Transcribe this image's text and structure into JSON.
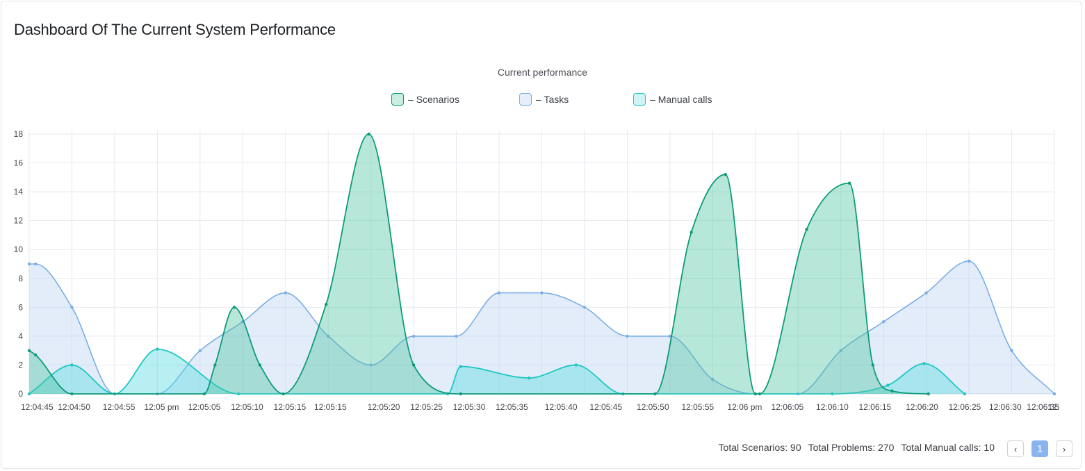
{
  "page": {
    "title": "Dashboard Of The Current System Performance"
  },
  "colors": {
    "scenarios_line": "#0e9b78",
    "scenarios_fill": "#4cc3a0",
    "tasks_line": "#7aaee6",
    "tasks_fill": "#a9c8f0",
    "manual_line": "#1fc7c4",
    "manual_fill": "#5fdbe2",
    "grid": "#e4e9f0"
  },
  "legend": [
    {
      "label": "Scenarios",
      "series": "scenarios"
    },
    {
      "label": "Tasks",
      "series": "tasks"
    },
    {
      "label": "Manual calls",
      "series": "manual"
    }
  ],
  "footer": {
    "scenarios_text": "Total Scenarios: 90",
    "problems_text": "Total Problems: 270",
    "manual_text": "Total Manual calls: 10"
  },
  "pagination": {
    "prev": "‹",
    "current": "1",
    "next": "›"
  },
  "chart_data": {
    "type": "area",
    "title": "Current performance",
    "ylim": [
      0,
      18
    ],
    "yticks": [
      0,
      2,
      4,
      6,
      8,
      10,
      12,
      14,
      16,
      18
    ],
    "xlim": [
      0,
      24
    ],
    "xticks": [
      {
        "x": 0.18,
        "label": "12:04:45"
      },
      {
        "x": 1.05,
        "label": "12:04:50"
      },
      {
        "x": 2.1,
        "label": "12:04:55"
      },
      {
        "x": 3.1,
        "label": "12:05 pm"
      },
      {
        "x": 4.1,
        "label": "12:05:05"
      },
      {
        "x": 5.1,
        "label": "12:05:10"
      },
      {
        "x": 6.1,
        "label": "12:05:15"
      },
      {
        "x": 7.05,
        "label": "12:05:15"
      },
      {
        "x": 8.3,
        "label": "12:05:20"
      },
      {
        "x": 9.3,
        "label": "12:05:25"
      },
      {
        "x": 10.3,
        "label": "12:05:30"
      },
      {
        "x": 11.3,
        "label": "12:05:35"
      },
      {
        "x": 12.45,
        "label": "12:05:40"
      },
      {
        "x": 13.5,
        "label": "12:05:45"
      },
      {
        "x": 14.6,
        "label": "12:05:50"
      },
      {
        "x": 15.65,
        "label": "12:05:55"
      },
      {
        "x": 16.75,
        "label": "12:06 pm"
      },
      {
        "x": 17.75,
        "label": "12:06:05"
      },
      {
        "x": 18.8,
        "label": "12:06:10"
      },
      {
        "x": 19.8,
        "label": "12:06:15"
      },
      {
        "x": 20.9,
        "label": "12:06:20"
      },
      {
        "x": 21.9,
        "label": "12:06:25"
      },
      {
        "x": 22.85,
        "label": "12:06:30"
      },
      {
        "x": 23.8,
        "label": "12:06:35"
      },
      {
        "x": 24.3,
        "label": "12:"
      }
    ],
    "grid": true,
    "legend_position": "top-center",
    "series": [
      {
        "name": "Tasks",
        "key": "tasks",
        "points": [
          {
            "x": 0,
            "y": 9
          },
          {
            "x": 0.15,
            "y": 9
          },
          {
            "x": 1,
            "y": 6
          },
          {
            "x": 2,
            "y": 0
          },
          {
            "x": 3,
            "y": 0
          },
          {
            "x": 4,
            "y": 3
          },
          {
            "x": 5,
            "y": 5
          },
          {
            "x": 6,
            "y": 7
          },
          {
            "x": 7,
            "y": 4
          },
          {
            "x": 8,
            "y": 2
          },
          {
            "x": 9,
            "y": 4
          },
          {
            "x": 10,
            "y": 4
          },
          {
            "x": 11,
            "y": 7
          },
          {
            "x": 12,
            "y": 7
          },
          {
            "x": 13,
            "y": 6
          },
          {
            "x": 14,
            "y": 4
          },
          {
            "x": 15,
            "y": 4
          },
          {
            "x": 16,
            "y": 1
          },
          {
            "x": 17,
            "y": 0
          },
          {
            "x": 18,
            "y": 0
          },
          {
            "x": 19,
            "y": 3
          },
          {
            "x": 20,
            "y": 5
          },
          {
            "x": 21,
            "y": 7
          },
          {
            "x": 22,
            "y": 9.2
          },
          {
            "x": 23,
            "y": 3
          },
          {
            "x": 24,
            "y": 0
          }
        ]
      },
      {
        "name": "Manual calls",
        "key": "manual",
        "points": [
          {
            "x": 0,
            "y": 0
          },
          {
            "x": 1,
            "y": 2
          },
          {
            "x": 2,
            "y": 0
          },
          {
            "x": 3,
            "y": 3.1
          },
          {
            "x": 4.9,
            "y": 0
          },
          {
            "x": 9.8,
            "y": 0
          },
          {
            "x": 10.1,
            "y": 1.9
          },
          {
            "x": 11.7,
            "y": 1.1
          },
          {
            "x": 12.8,
            "y": 2
          },
          {
            "x": 13.9,
            "y": 0
          },
          {
            "x": 18.8,
            "y": 0
          },
          {
            "x": 20.1,
            "y": 0.6
          },
          {
            "x": 20.95,
            "y": 2.1
          },
          {
            "x": 21.9,
            "y": 0
          }
        ]
      },
      {
        "name": "Scenarios",
        "key": "scenarios",
        "points": [
          {
            "x": 0,
            "y": 3
          },
          {
            "x": 0.15,
            "y": 2.7
          },
          {
            "x": 1,
            "y": 0
          },
          {
            "x": 4.1,
            "y": 0
          },
          {
            "x": 4.35,
            "y": 2
          },
          {
            "x": 4.8,
            "y": 6
          },
          {
            "x": 5.4,
            "y": 2
          },
          {
            "x": 5.95,
            "y": 0
          },
          {
            "x": 6.95,
            "y": 6.2
          },
          {
            "x": 7.95,
            "y": 18
          },
          {
            "x": 9,
            "y": 2
          },
          {
            "x": 10.1,
            "y": 0
          },
          {
            "x": 14.65,
            "y": 0
          },
          {
            "x": 15.5,
            "y": 11.2
          },
          {
            "x": 16.3,
            "y": 15.2
          },
          {
            "x": 17.0,
            "y": 0
          },
          {
            "x": 17.1,
            "y": 0
          },
          {
            "x": 18.2,
            "y": 11.4
          },
          {
            "x": 19.2,
            "y": 14.6
          },
          {
            "x": 19.75,
            "y": 2
          },
          {
            "x": 20.2,
            "y": 0.2
          },
          {
            "x": 21.05,
            "y": 0
          }
        ]
      }
    ]
  }
}
